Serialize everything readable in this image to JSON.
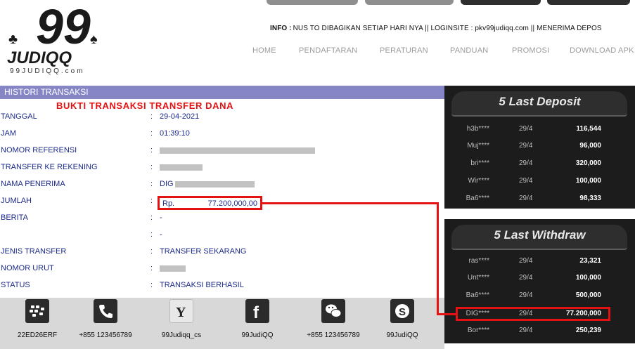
{
  "brand": {
    "logo_big": "99",
    "logo_word": "JUDIQQ",
    "logo_site": "99JUDIQQ.com"
  },
  "info": {
    "label": "INFO :",
    "text": "NUS TO DIBAGIKAN SETIAP HARI NYA || LOGINSITE : pkv99judiqq.com || MENERIMA DEPOS"
  },
  "menu": [
    "HOME",
    "PENDAFTARAN",
    "PERATURAN",
    "PANDUAN",
    "PROMOSI",
    "DOWNLOAD APK"
  ],
  "history": {
    "header": "HISTORI TRANSAKSI",
    "receipt_title": "BUKTI TRANSAKSI TRANSFER DANA",
    "separator": ":",
    "rows": [
      {
        "label": "TANGGAL",
        "value": "29-04-2021"
      },
      {
        "label": "JAM",
        "value": "01:39:10"
      },
      {
        "label": "NOMOR REFERENSI",
        "value": ""
      },
      {
        "label": "TRANSFER KE REKENING",
        "value": ""
      },
      {
        "label": "NAMA PENERIMA",
        "value": "DIG"
      },
      {
        "label": "JUMLAH",
        "value": ""
      },
      {
        "label": "BERITA",
        "value": "-"
      },
      {
        "label": "",
        "value": "-"
      },
      {
        "label": "JENIS TRANSFER",
        "value": "TRANSFER SEKARANG"
      },
      {
        "label": "NOMOR URUT",
        "value": ""
      },
      {
        "label": "STATUS",
        "value": "TRANSAKSI BERHASIL"
      }
    ],
    "amount_currency": "Rp.",
    "amount_value": "77.200,000,00"
  },
  "contacts": [
    {
      "icon": "blackberry-icon",
      "text": "22ED26ERF"
    },
    {
      "icon": "phone-icon",
      "text": "+855 123456789"
    },
    {
      "icon": "yahoo-icon",
      "text": "99Judiqq_cs"
    },
    {
      "icon": "facebook-icon",
      "text": "99JudiQQ"
    },
    {
      "icon": "wechat-icon",
      "text": "+855 123456789"
    },
    {
      "icon": "skype-icon",
      "text": "99JudiQQ"
    }
  ],
  "last_deposit": {
    "title": "5 Last Deposit",
    "rows": [
      {
        "name": "h3b****",
        "date": "29/4",
        "amount": "116,544"
      },
      {
        "name": "Muj****",
        "date": "29/4",
        "amount": "96,000"
      },
      {
        "name": "bri****",
        "date": "29/4",
        "amount": "320,000"
      },
      {
        "name": "Wir****",
        "date": "29/4",
        "amount": "100,000"
      },
      {
        "name": "Ba6****",
        "date": "29/4",
        "amount": "98,333"
      }
    ]
  },
  "last_withdraw": {
    "title": "5 Last Withdraw",
    "rows": [
      {
        "name": "ras****",
        "date": "29/4",
        "amount": "23,321"
      },
      {
        "name": "Unt****",
        "date": "29/4",
        "amount": "100,000"
      },
      {
        "name": "Ba6****",
        "date": "29/4",
        "amount": "500,000"
      },
      {
        "name": "DIG****",
        "date": "29/4",
        "amount": "77.200,000"
      },
      {
        "name": "Bor****",
        "date": "29/4",
        "amount": "250,239"
      }
    ]
  },
  "colors": {
    "header_bar": "#8686c6",
    "label_text": "#1b2a8a",
    "highlight": "#e41212",
    "sidebar_bg": "#1c1c1c",
    "footer_bg": "#d8d8d8"
  }
}
